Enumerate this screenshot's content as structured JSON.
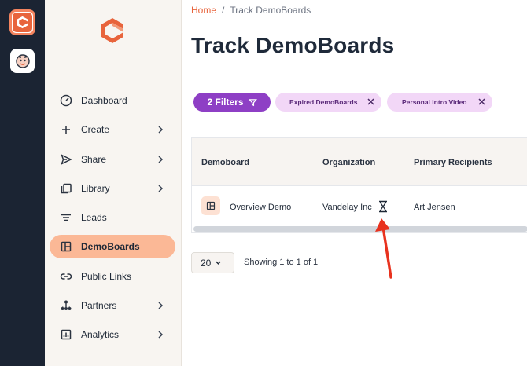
{
  "breadcrumb": {
    "home": "Home",
    "separator": "/",
    "current": "Track DemoBoards"
  },
  "page_title": "Track DemoBoards",
  "sidebar": {
    "items": [
      {
        "label": "Dashboard",
        "icon": "gauge-icon",
        "has_chevron": false,
        "active": false
      },
      {
        "label": "Create",
        "icon": "plus-icon",
        "has_chevron": true,
        "active": false
      },
      {
        "label": "Share",
        "icon": "send-icon",
        "has_chevron": true,
        "active": false
      },
      {
        "label": "Library",
        "icon": "library-icon",
        "has_chevron": true,
        "active": false
      },
      {
        "label": "Leads",
        "icon": "lines-icon",
        "has_chevron": false,
        "active": false
      },
      {
        "label": "DemoBoards",
        "icon": "board-icon",
        "has_chevron": false,
        "active": true
      },
      {
        "label": "Public Links",
        "icon": "link-icon",
        "has_chevron": false,
        "active": false
      },
      {
        "label": "Partners",
        "icon": "partners-icon",
        "has_chevron": true,
        "active": false
      },
      {
        "label": "Analytics",
        "icon": "analytics-icon",
        "has_chevron": true,
        "active": false
      }
    ]
  },
  "filters": {
    "button_label": "2 Filters",
    "chips": [
      {
        "label": "Expired DemoBoards"
      },
      {
        "label": "Personal Intro Video"
      }
    ]
  },
  "table": {
    "columns": [
      "Demoboard",
      "Organization",
      "Primary Recipients"
    ],
    "rows": [
      {
        "demoboard": "Overview Demo",
        "organization": "Vandelay Inc",
        "status_icon": "hourglass-icon",
        "primary_recipients": "Art Jensen"
      }
    ]
  },
  "pagination": {
    "page_size": "20",
    "summary": "Showing 1 to 1 of 1"
  },
  "colors": {
    "brand": "#e8643c",
    "rail": "#1b2433",
    "sidebar_bg": "#f8f5f1",
    "active_item": "#fbb896",
    "filters_button": "#8e3fc5",
    "filter_chip": "#f2d7f7",
    "annotation_arrow": "#e8321e"
  }
}
